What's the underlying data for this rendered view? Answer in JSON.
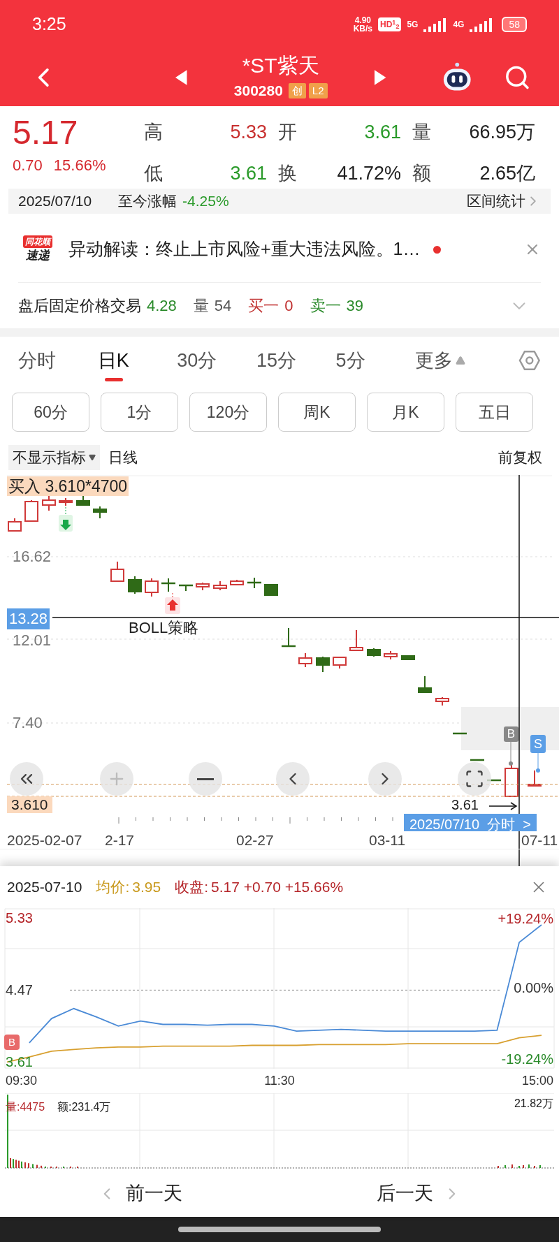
{
  "status_bar": {
    "time": "3:25",
    "net_speed": "4.90",
    "net_unit": "KB/s",
    "hd": "HD$^{1}$$_{2}$",
    "signal_1": "5G",
    "signal_2": "4G",
    "battery": "58"
  },
  "header": {
    "title": "*ST紫天",
    "code": "300280",
    "badges": [
      "创",
      "L2"
    ]
  },
  "quote": {
    "price": "5.17",
    "change": "0.70",
    "change_pct": "15.66%",
    "stats": [
      {
        "label": "高",
        "value": "5.33",
        "color": "#c8302f"
      },
      {
        "label": "开",
        "value": "3.61",
        "color": "#2a9a2a"
      },
      {
        "label": "量",
        "value": "66.95万",
        "color": "#222222"
      },
      {
        "label": "低",
        "value": "3.61",
        "color": "#2a9a2a"
      },
      {
        "label": "换",
        "value": "41.72%",
        "color": "#222222"
      },
      {
        "label": "额",
        "value": "2.65亿",
        "color": "#222222"
      }
    ]
  },
  "range": {
    "date": "2025/07/10",
    "label": "至今涨幅",
    "value": "-4.25%",
    "link": "区间统计"
  },
  "news": {
    "logo_top": "同花顺",
    "logo_bottom": "速递",
    "text": "异动解读：终止上市风险+重大违法风险。1…",
    "unread": true
  },
  "after_hours": {
    "label": "盘后固定价格交易",
    "price": "4.28",
    "items": [
      {
        "label": "量",
        "value": "54",
        "color": "#555555"
      },
      {
        "label": "买一",
        "value": "0",
        "color": "#c0302f"
      },
      {
        "label": "卖一",
        "value": "39",
        "color": "#2a8a2a"
      }
    ]
  },
  "period_tabs": [
    {
      "label": "分时",
      "selected": false,
      "kind": "tab"
    },
    {
      "label": "日K",
      "selected": true,
      "kind": "tab"
    },
    {
      "label": "30分",
      "selected": false,
      "kind": "tab"
    },
    {
      "label": "15分",
      "selected": false,
      "kind": "tab"
    },
    {
      "label": "5分",
      "selected": false,
      "kind": "tab"
    },
    {
      "label": "更多",
      "selected": false,
      "kind": "menu"
    }
  ],
  "period_buttons": [
    "60分",
    "1分",
    "120分",
    "周K",
    "月K",
    "五日"
  ],
  "indicator_bar": {
    "indicator": "不显示指标",
    "line": "日线",
    "adjust": "前复权"
  },
  "kline": {
    "trade_tag": "买入 3.610*4700",
    "y_labels": [
      "16.62",
      "12.01",
      "7.40"
    ],
    "cursor_price": "13.28",
    "strategy": "BOLL策略",
    "cost_line": "3.610",
    "low_marker": "3.61",
    "buy_tag": "B",
    "sell_tag": "S",
    "x_labels": [
      "2025-02-07",
      "2-17",
      "02-27",
      "03-11",
      "07-11"
    ],
    "cursor_date": "2025/07/10  分时  >"
  },
  "intraday": {
    "date": "2025-07-10",
    "avg": "3.95",
    "close_label": "收盘:",
    "close": "5.17 +0.70 +15.66%",
    "pct_high": "+19.24%",
    "pct_mid": "0.00%",
    "pct_low": "-19.24%",
    "buy_tag": "B",
    "times": [
      "09:30",
      "11:30",
      "15:00"
    ],
    "chart_data": {
      "type": "line",
      "grid": true,
      "ylim": [
        3.53,
        5.45
      ],
      "yticks": [
        {
          "value": 5.33,
          "label": "5.33"
        },
        {
          "value": 4.47,
          "label": "4.47"
        },
        {
          "value": 3.61,
          "label": "3.61"
        }
      ],
      "series": [
        {
          "color": "#4a8ad6",
          "values": [
            null,
            3.84,
            4.13,
            4.25,
            4.15,
            4.04,
            4.1,
            4.06,
            4.06,
            4.05,
            4.06,
            4.06,
            4.04,
            3.98,
            3.99,
            4.0,
            3.99,
            3.98,
            3.98,
            3.98,
            3.98,
            3.98,
            3.99,
            5.04,
            5.25
          ]
        },
        {
          "name": "均价:",
          "color": "#d8a030",
          "values": [
            3.61,
            3.67,
            3.74,
            3.76,
            3.78,
            3.79,
            3.79,
            3.8,
            3.8,
            3.8,
            3.8,
            3.81,
            3.81,
            3.81,
            3.82,
            3.82,
            3.82,
            3.82,
            3.83,
            3.83,
            3.83,
            3.83,
            3.83,
            3.9,
            3.93
          ]
        }
      ]
    },
    "volume": "量:4475",
    "amount": "额:231.4万",
    "max_volume": "21.82万",
    "prev": "前一天",
    "next": "后一天"
  }
}
